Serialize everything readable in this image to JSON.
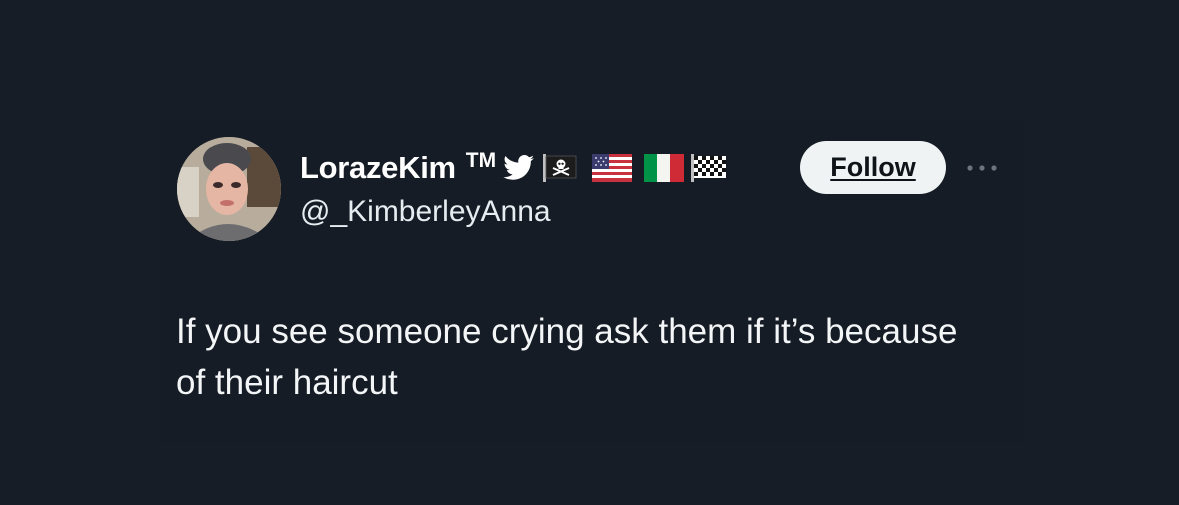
{
  "tweet": {
    "display_name": "LorazeKim",
    "trademark": "TM",
    "handle": "@_KimberleyAnna",
    "follow_label": "Follow",
    "text": "If you see someone crying ask them if it’s because of their haircut",
    "name_icons": [
      "twitter-bird-icon",
      "pirate-flag-icon",
      "us-flag-icon",
      "italy-flag-icon",
      "checkered-flag-icon"
    ],
    "more_icon": "more-dots-icon"
  },
  "colors": {
    "background": "#161d26",
    "text_primary": "#ffffff",
    "text_secondary": "#e7ecf0",
    "follow_bg": "#eff3f4",
    "follow_text": "#0f1419"
  }
}
